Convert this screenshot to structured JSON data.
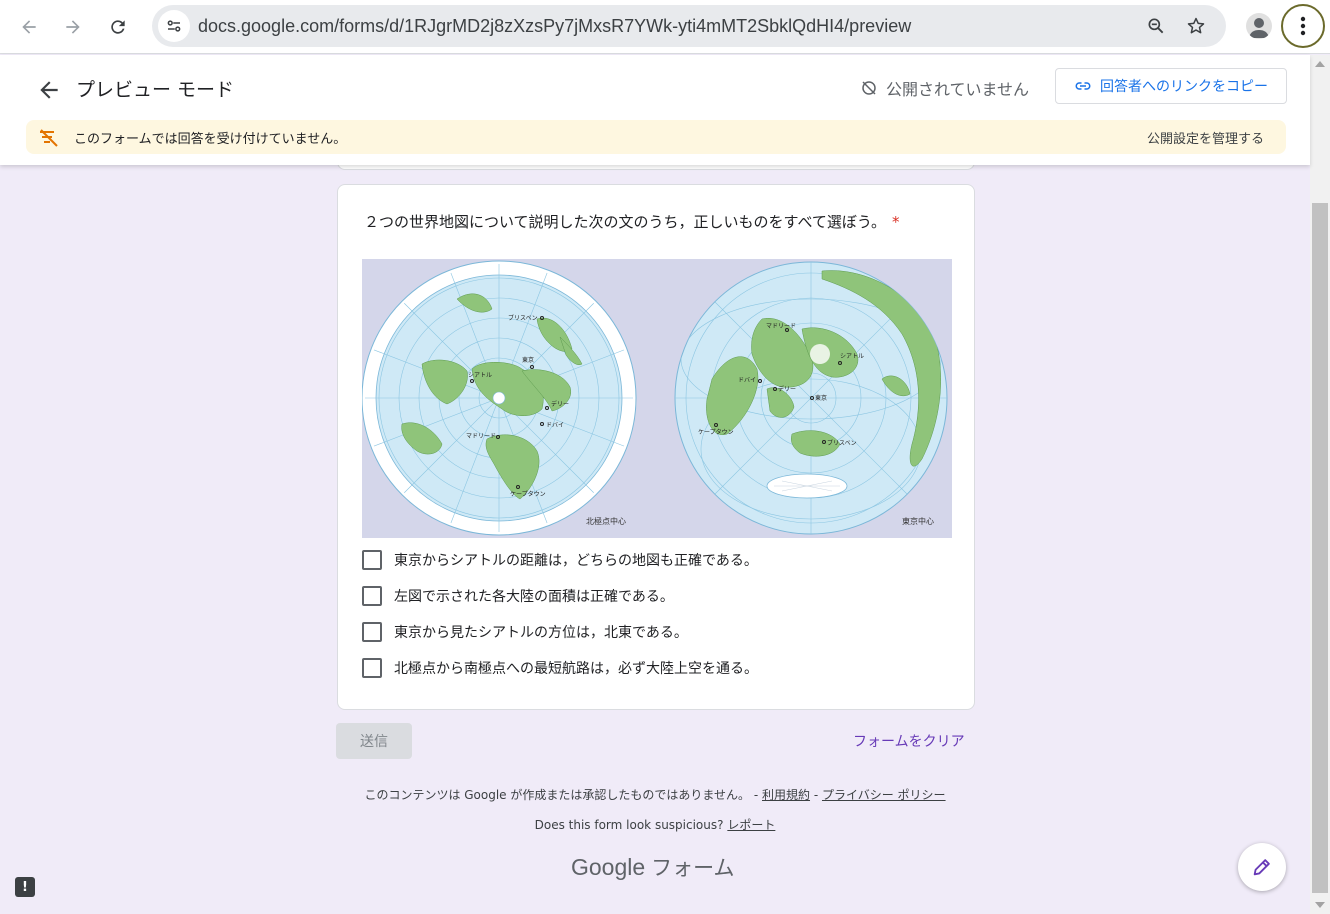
{
  "browser": {
    "url": "docs.google.com/forms/d/1RJgrMD2j8zXzsPy7jMxsR7YWk-yti4mMT2SbklQdHI4/preview",
    "icons": [
      "back-icon",
      "forward-icon",
      "reload-icon",
      "site-info-icon",
      "zoom-icon",
      "star-icon",
      "profile-icon",
      "more-menu-icon"
    ]
  },
  "header": {
    "title": "プレビュー モード",
    "status": "公開されていません",
    "copy_link": "回答者へのリンクをコピー"
  },
  "banner": {
    "message": "このフォームでは回答を受け付けていません。",
    "action": "公開設定を管理する"
  },
  "question": {
    "title": "２つの世界地図について説明した次の文のうち，正しいものをすべて選ぼう。",
    "required_mark": "*",
    "image": {
      "left_caption": "北極点中心",
      "right_caption": "東京中心",
      "left_cities": [
        "ブリスベン",
        "東京",
        "シアトル",
        "デリー",
        "マドリード",
        "ドバイ",
        "ケープタウン"
      ],
      "right_cities": [
        "マドリード",
        "シアトル",
        "ドバイ",
        "デリー",
        "東京",
        "ケープタウン",
        "ブリスベン"
      ]
    },
    "options": [
      "東京からシアトルの距離は，どちらの地図も正確である。",
      "左図で示された各大陸の面積は正確である。",
      "東京から見たシアトルの方位は，北東である。",
      "北極点から南極点への最短航路は，必ず大陸上空を通る。"
    ]
  },
  "actions": {
    "submit": "送信",
    "clear": "フォームをクリア"
  },
  "footer": {
    "disclaimer": "このコンテンツは Google が作成または承認したものではありません。",
    "sep1": " - ",
    "terms": "利用規約",
    "sep2": " - ",
    "privacy": "プライバシー ポリシー",
    "suspicious": "Does this form look suspicious?",
    "report": "レポート",
    "brand_google": "Google",
    "brand_forms": "フォーム"
  },
  "colors": {
    "accent": "#673ab7",
    "link_blue": "#1a73e8",
    "background": "#f0ebf8",
    "banner": "#fef7e0",
    "required": "#d93025",
    "ocean": "#cfe9f6",
    "land": "#8fc47a"
  }
}
